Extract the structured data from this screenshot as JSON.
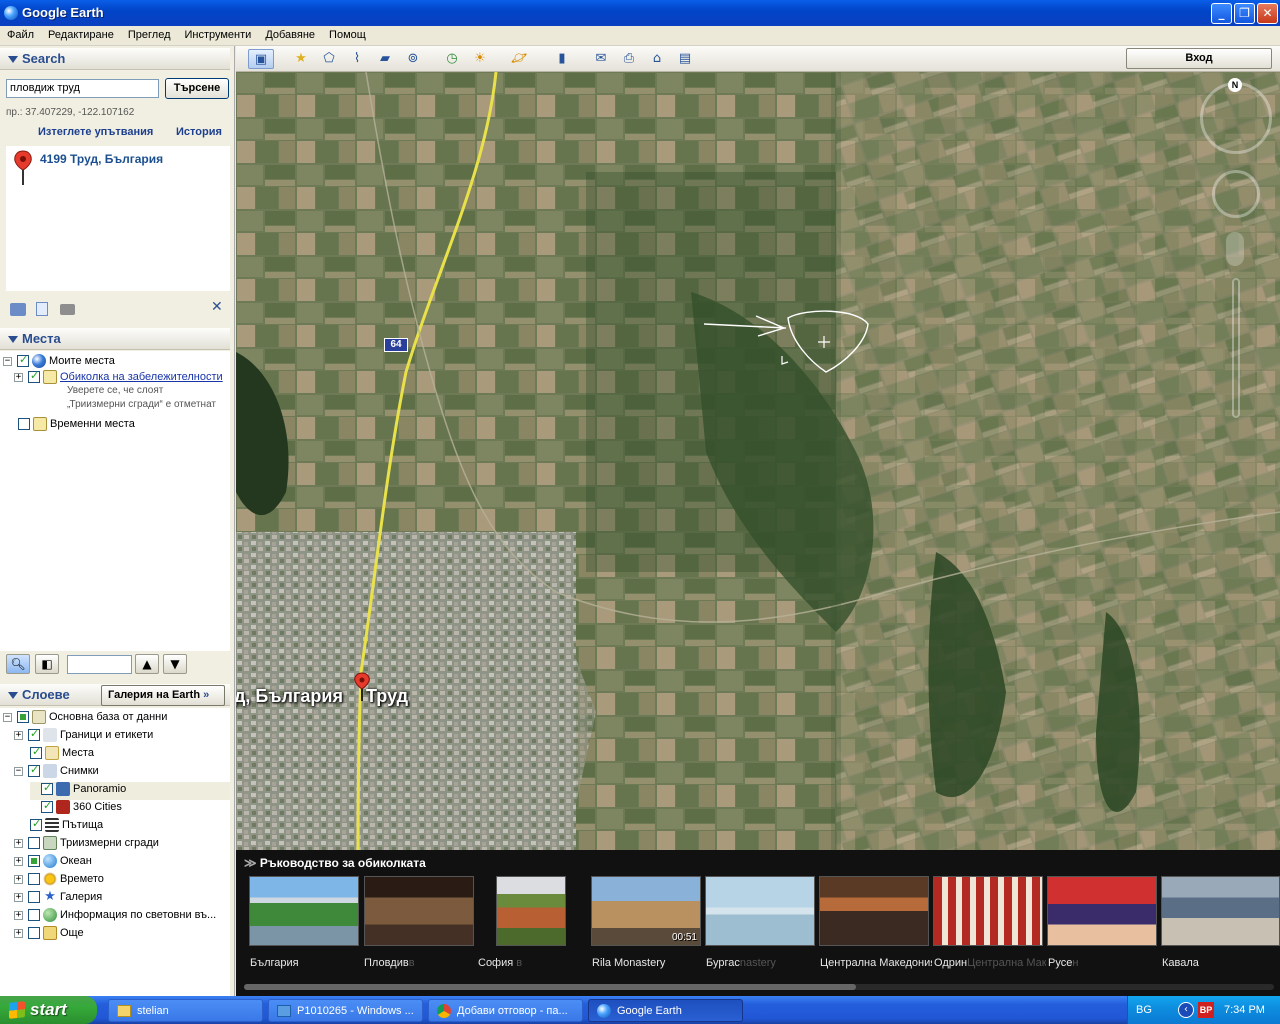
{
  "window": {
    "title": "Google Earth"
  },
  "menu": [
    "Файл",
    "Редактиране",
    "Преглед",
    "Инструменти",
    "Добавяне",
    "Помощ"
  ],
  "search": {
    "header": "Search",
    "query": "пловдиж труд",
    "button": "Търсене",
    "example": "пр.: 37.407229, -122.107162",
    "clear_directions": "Изтеглете упътвания",
    "history": "История",
    "result": "4199 Труд, България"
  },
  "places": {
    "header": "Места",
    "my_places": "Моите места",
    "tour": "Обиколка на забележителности",
    "tour_note1": "Уверете се, че слоят",
    "tour_note2": "„Триизмерни сгради“ е отметнат",
    "temp_places": "Временни места"
  },
  "layers": {
    "header": "Слоеве",
    "gallery_button": "Галерия на Earth",
    "items": [
      {
        "label": "Основна база от данни"
      },
      {
        "label": "Граници и етикети"
      },
      {
        "label": "Места"
      },
      {
        "label": "Снимки"
      },
      {
        "label": "Panoramio"
      },
      {
        "label": "360 Cities"
      },
      {
        "label": "Пътища"
      },
      {
        "label": "Триизмерни сгради"
      },
      {
        "label": "Океан"
      },
      {
        "label": "Времето"
      },
      {
        "label": "Галерия"
      },
      {
        "label": "Информация по световни въ..."
      },
      {
        "label": "Още"
      }
    ]
  },
  "toolbar": {
    "signin": "Вход"
  },
  "map": {
    "road_label": "64",
    "place_label_1": "д, България",
    "place_label_2": "Труд",
    "compass": "N"
  },
  "tour_guide": {
    "header": "Ръководство за обиколката",
    "duration": "00:51",
    "items": [
      {
        "label": "България",
        "ghost": ""
      },
      {
        "label": "Пловдив",
        "ghost": "в"
      },
      {
        "label": "София",
        "ghost": " в"
      },
      {
        "label": "Rila Monastery",
        "ghost": ""
      },
      {
        "label": "Бургас",
        "ghost": "nastery"
      },
      {
        "label": "Централна Македония",
        "ghost": ""
      },
      {
        "label": "Одрин",
        "ghost": "Централна Македони"
      },
      {
        "label": "Русе",
        "ghost": "н"
      },
      {
        "label": "Кавала",
        "ghost": ""
      }
    ]
  },
  "taskbar": {
    "start": "start",
    "tasks": [
      "stelian",
      "P1010265 - Windows ...",
      "Добави отговор - па...",
      "Google Earth"
    ],
    "lang": "BG",
    "clock": "7:34 PM"
  }
}
